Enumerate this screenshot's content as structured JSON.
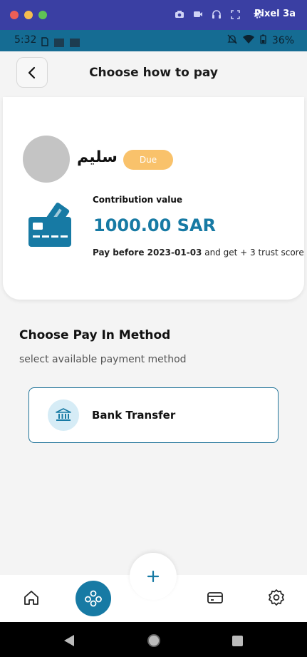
{
  "emulator": {
    "device_name": "Pixel 3a"
  },
  "status_bar": {
    "time": "5:32",
    "battery": "36%"
  },
  "header": {
    "title": "Choose how to pay"
  },
  "card": {
    "name": "سليم",
    "badge": "Due",
    "contribution_label": "Contribution value",
    "amount": "1000.00 SAR",
    "pay_before_prefix": "Pay before 2023-01-03",
    "pay_before_suffix": "and get + 3 trust score"
  },
  "method_section": {
    "title": "Choose Pay In Method",
    "subtitle": "select available payment method",
    "methods": [
      {
        "label": "Bank Transfer",
        "icon": "bank-icon"
      }
    ]
  },
  "bottom_nav": {
    "items": [
      {
        "icon": "home-icon"
      },
      {
        "icon": "group-icon",
        "active": true
      },
      {
        "icon": "plus-icon"
      },
      {
        "icon": "card-icon"
      },
      {
        "icon": "settings-icon"
      }
    ]
  },
  "colors": {
    "primary": "#177aa4",
    "badge": "#f9c26b",
    "bank_circle": "#d6ecf6"
  }
}
